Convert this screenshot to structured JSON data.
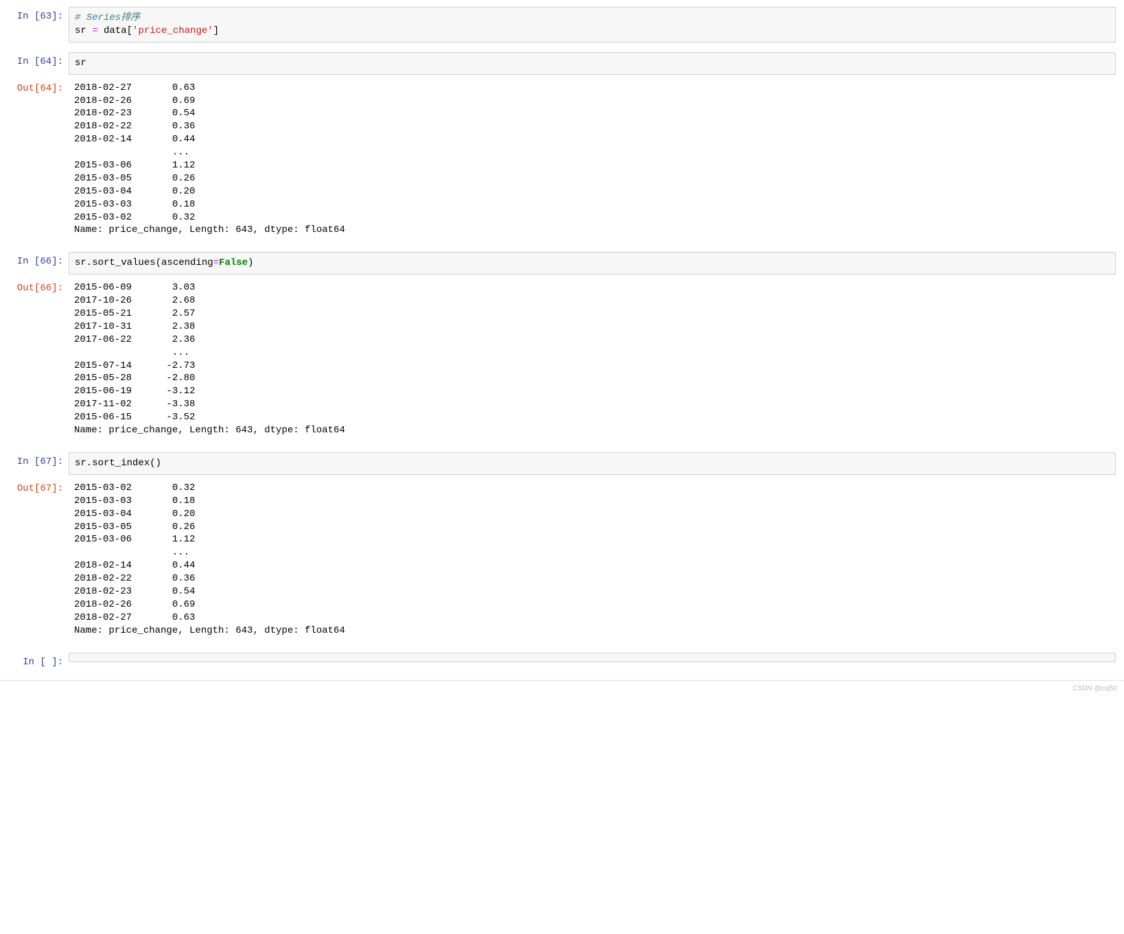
{
  "cells": {
    "c63": {
      "in_prompt": "In  [63]:",
      "code": "<span class=\"c-comment\"># Series排序</span>\nsr <span class=\"c-op\">=</span> data[<span class=\"c-str\">'price_change'</span>]"
    },
    "c64": {
      "in_prompt": "In  [64]:",
      "code": "sr",
      "out_prompt": "Out[64]:",
      "rows": [
        [
          "2018-02-27",
          "0.63"
        ],
        [
          "2018-02-26",
          "0.69"
        ],
        [
          "2018-02-23",
          "0.54"
        ],
        [
          "2018-02-22",
          "0.36"
        ],
        [
          "2018-02-14",
          "0.44"
        ],
        [
          null,
          "... "
        ],
        [
          "2015-03-06",
          "1.12"
        ],
        [
          "2015-03-05",
          "0.26"
        ],
        [
          "2015-03-04",
          "0.20"
        ],
        [
          "2015-03-03",
          "0.18"
        ],
        [
          "2015-03-02",
          "0.32"
        ]
      ],
      "tail": "Name: price_change, Length: 643, dtype: float64"
    },
    "c66": {
      "in_prompt": "In  [66]:",
      "code": "sr.sort_values(ascending<span class=\"c-op\">=</span><span class=\"c-kw\">False</span>)",
      "out_prompt": "Out[66]:",
      "rows": [
        [
          "2015-06-09",
          "3.03"
        ],
        [
          "2017-10-26",
          "2.68"
        ],
        [
          "2015-05-21",
          "2.57"
        ],
        [
          "2017-10-31",
          "2.38"
        ],
        [
          "2017-06-22",
          "2.36"
        ],
        [
          null,
          "... "
        ],
        [
          "2015-07-14",
          "-2.73"
        ],
        [
          "2015-05-28",
          "-2.80"
        ],
        [
          "2015-06-19",
          "-3.12"
        ],
        [
          "2017-11-02",
          "-3.38"
        ],
        [
          "2015-06-15",
          "-3.52"
        ]
      ],
      "tail": "Name: price_change, Length: 643, dtype: float64"
    },
    "c67": {
      "in_prompt": "In  [67]:",
      "code": "sr.sort_index()",
      "out_prompt": "Out[67]:",
      "rows": [
        [
          "2015-03-02",
          "0.32"
        ],
        [
          "2015-03-03",
          "0.18"
        ],
        [
          "2015-03-04",
          "0.20"
        ],
        [
          "2015-03-05",
          "0.26"
        ],
        [
          "2015-03-06",
          "1.12"
        ],
        [
          null,
          "... "
        ],
        [
          "2018-02-14",
          "0.44"
        ],
        [
          "2018-02-22",
          "0.36"
        ],
        [
          "2018-02-23",
          "0.54"
        ],
        [
          "2018-02-26",
          "0.69"
        ],
        [
          "2018-02-27",
          "0.63"
        ]
      ],
      "tail": "Name: price_change, Length: 643, dtype: float64"
    },
    "cEmpty": {
      "in_prompt": "In  [ ]:",
      "code": ""
    }
  },
  "format": {
    "col1_width": 10,
    "col2_width": 8
  },
  "footer": "CSDN @csj50"
}
